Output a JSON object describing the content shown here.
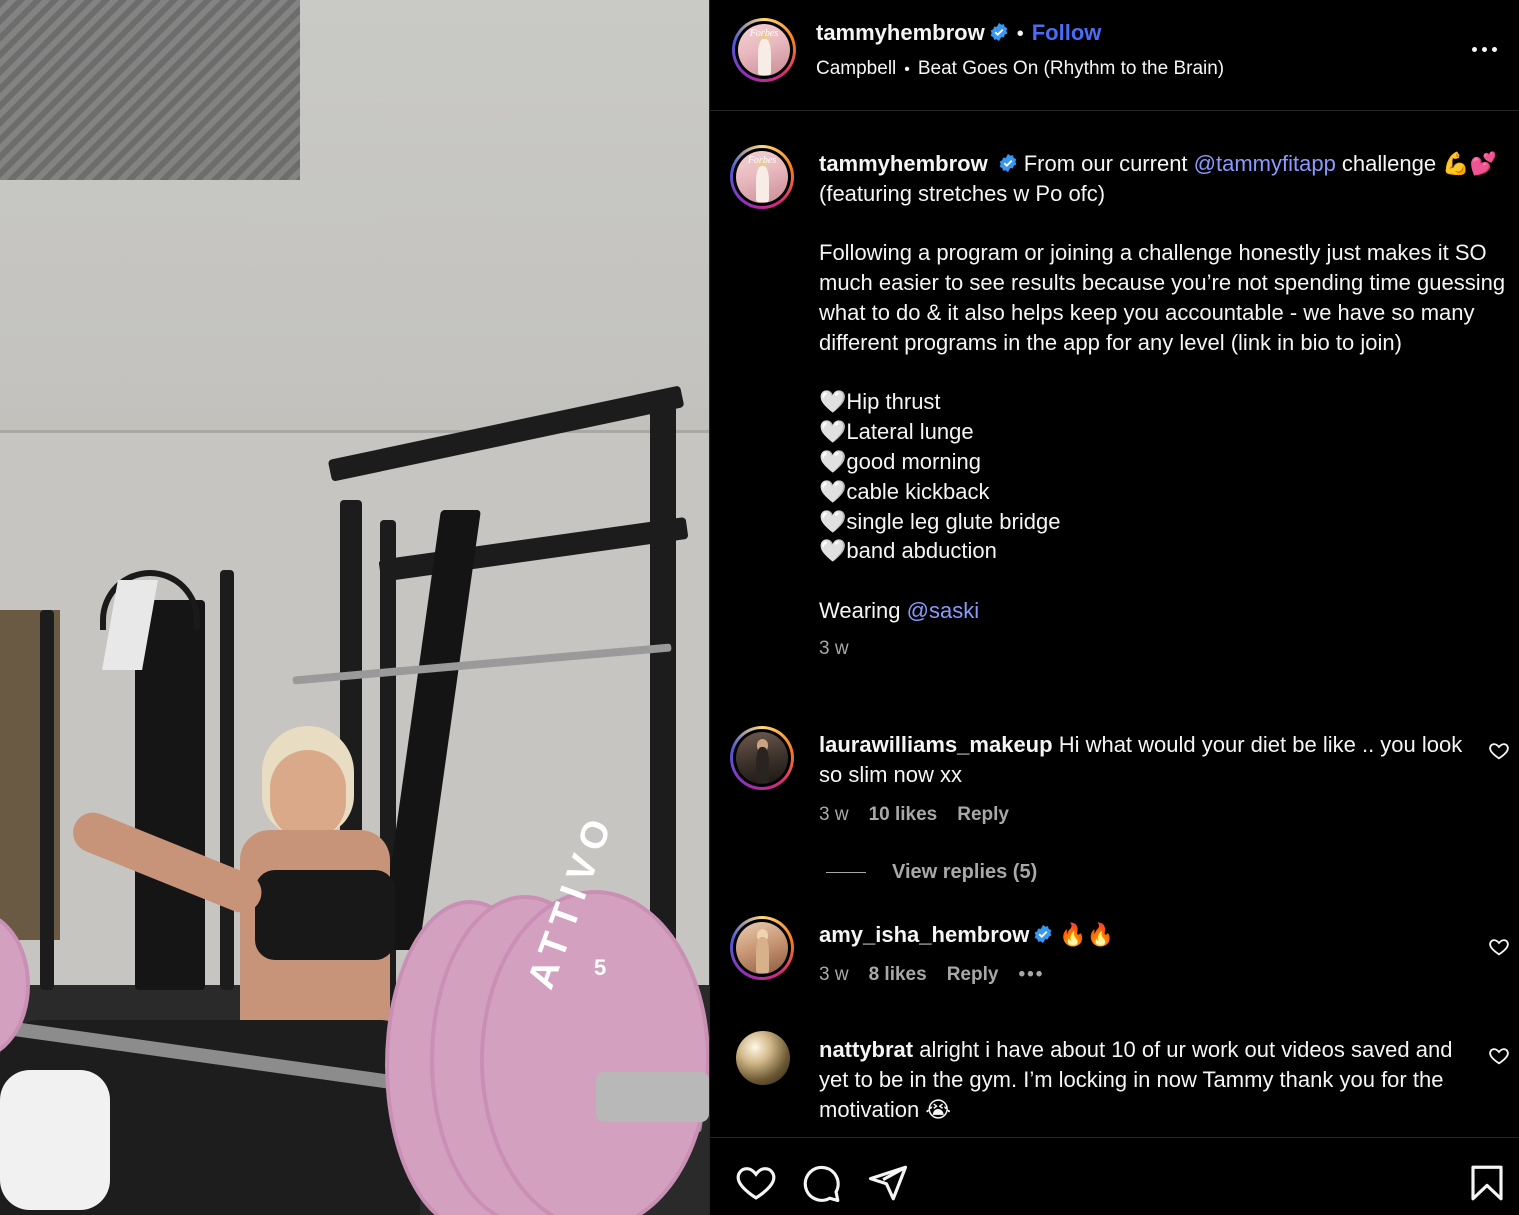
{
  "post": {
    "author": "tammyhembrow",
    "follow_label": "Follow",
    "dot": "•",
    "music_artist": "Campbell",
    "music_title": "Beat Goes On (Rhythm to the Brain)",
    "avatar_text": "Forbes"
  },
  "caption": {
    "author": "tammyhembrow",
    "line1_pre": "From our current ",
    "line1_mention": "@tammyfitapp",
    "line1_post": " challenge 💪💕 (featuring stretches w Po ofc)",
    "paragraph": "Following a program or joining a challenge honestly just makes it SO much easier to see results because you’re not spending time guessing what to do & it also helps keep you accountable - we have so many different programs in the app for any level (link in bio to join)",
    "exercises": [
      "🤍Hip thrust",
      "🤍Lateral lunge",
      "🤍good morning",
      "🤍cable kickback",
      "🤍single leg glute bridge",
      "🤍band abduction"
    ],
    "wearing_pre": "Wearing ",
    "wearing_mention": "@saski",
    "time": "3 w"
  },
  "comments": [
    {
      "user": "laurawilliams_makeup",
      "text": "Hi what would your diet be like .. you look so slim now xx",
      "time": "3 w",
      "likes": "10 likes",
      "reply": "Reply",
      "view_replies": "View replies (5)"
    },
    {
      "user": "amy_isha_hembrow",
      "text": "🔥🔥",
      "time": "3 w",
      "likes": "8 likes",
      "reply": "Reply"
    },
    {
      "user": "nattybrat",
      "text": "alright i have about 10 of ur work out videos saved and yet to be in the gym. I’m locking in now Tammy thank you for the motivation 😭"
    }
  ],
  "media": {
    "plate_text": "ATTIVO",
    "plate_number": "5"
  },
  "colors": {
    "follow": "#4a6cf7",
    "mention": "#8c9aff",
    "verified": "#3897f0",
    "background": "#000000"
  },
  "icons": [
    "verified-icon",
    "more-icon",
    "heart-icon",
    "comment-icon",
    "share-icon",
    "bookmark-icon"
  ]
}
